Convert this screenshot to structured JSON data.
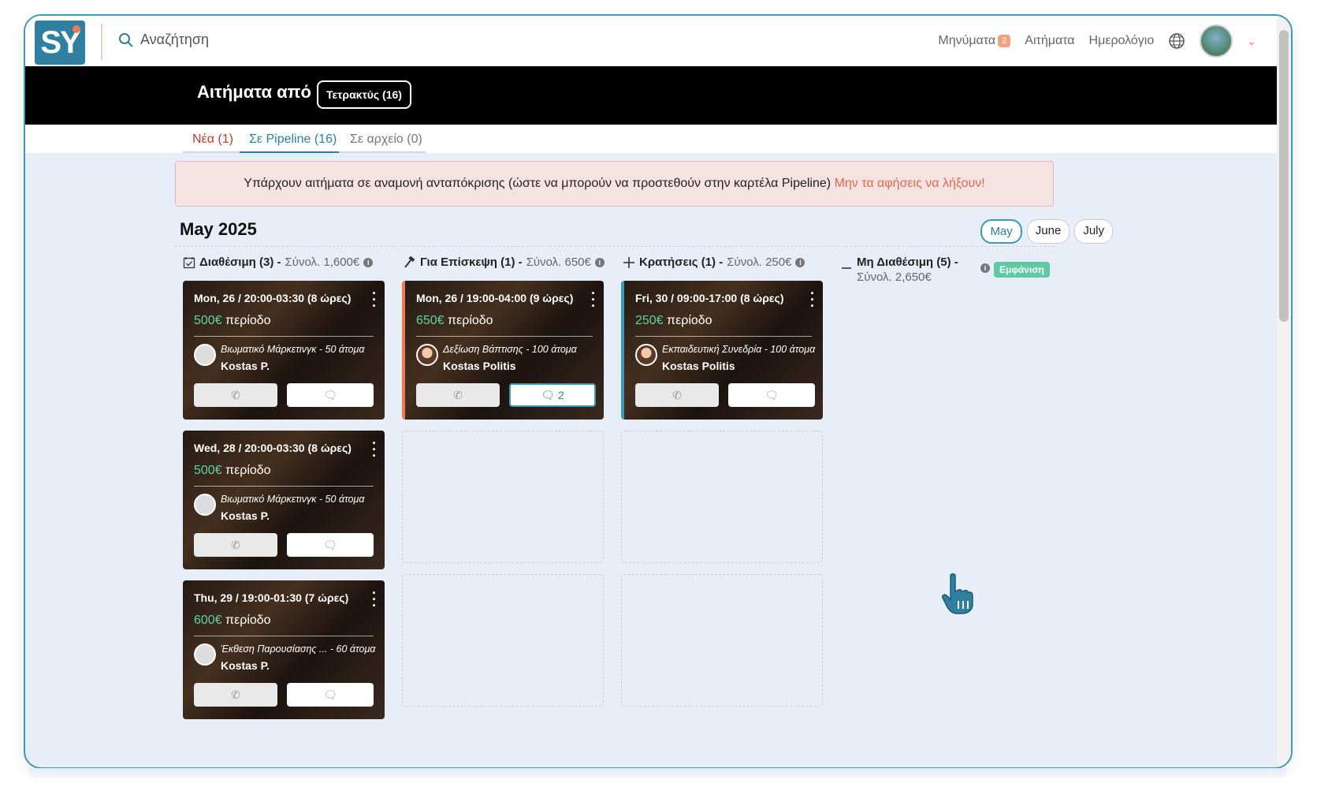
{
  "header": {
    "logo_text": "SY",
    "search_placeholder": "Αναζήτηση",
    "nav": {
      "messages_label": "Μηνύματα",
      "messages_count": "2",
      "requests_label": "Αιτήματα",
      "calendar_label": "Ημερολόγιο"
    }
  },
  "banner": {
    "title": "Αιτήματα από",
    "source_chip": "Τετρακτύς (16)"
  },
  "tabs": [
    {
      "label": "Νέα (1)"
    },
    {
      "label": "Σε Pipeline (16)"
    },
    {
      "label": "Σε αρχείο (0)"
    }
  ],
  "alert": {
    "text": "Υπάρχουν αιτήματα σε αναμονή ανταπόκρισης (ώστε να μπορούν να προστεθούν στην καρτέλα Pipeline)",
    "warning": "Μην τα αφήσεις να λήξουν!"
  },
  "month": {
    "title": "May 2025",
    "buttons": [
      "May",
      "June",
      "July"
    ],
    "active": "May"
  },
  "columns": [
    {
      "title": "Διαθέσιμη (3) -",
      "sum": "Σύνολ. 1,600€"
    },
    {
      "title": "Για Επίσκεψη (1) -",
      "sum": "Σύνολ. 650€"
    },
    {
      "title": "Κρατήσεις (1) -",
      "sum": "Σύνολ. 250€"
    },
    {
      "title": "Μη Διαθέσιμη (5) -",
      "sum": "Σύνολ. 2,650€",
      "show_label": "Εμφάνιση"
    }
  ],
  "cards": {
    "available": [
      {
        "date": "Mon, 26 / 20:00-03:30 (8 ώρες)",
        "amount": "500€",
        "period": "περίοδο",
        "event": "Βιωματικό Μάρκετινγκ - 50 άτομα",
        "person": "Kostas P."
      },
      {
        "date": "Wed, 28 / 20:00-03:30 (8 ώρες)",
        "amount": "500€",
        "period": "περίοδο",
        "event": "Βιωματικό Μάρκετινγκ - 50 άτομα",
        "person": "Kostas P."
      },
      {
        "date": "Thu, 29 / 19:00-01:30 (7 ώρες)",
        "amount": "600€",
        "period": "περίοδο",
        "event": "Έκθεση Παρουσίασης ... - 60 άτομα",
        "person": "Kostas P."
      }
    ],
    "visit": [
      {
        "date": "Mon, 26 / 19:00-04:00 (9 ώρες)",
        "amount": "650€",
        "period": "περίοδο",
        "event": "Δεξίωση Βάπτισης - 100 άτομα",
        "person": "Kostas Politis",
        "msg_count": "2"
      }
    ],
    "booked": [
      {
        "date": "Fri, 30 / 09:00-17:00 (8 ώρες)",
        "amount": "250€",
        "period": "περίοδο",
        "event": "Εκπαιδευτική Συνεδρία - 100 άτομα",
        "person": "Kostas Politis"
      }
    ]
  }
}
